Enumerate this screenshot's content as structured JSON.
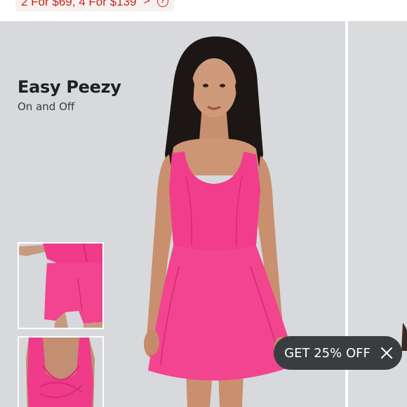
{
  "promo": {
    "text": "2 For $69, 4 For $139",
    "arrow": ">",
    "help": "?"
  },
  "product": {
    "title": "Easy Peezy",
    "subtitle": "On and Off"
  },
  "discount": {
    "label": "GET 25% OFF"
  },
  "colors": {
    "promo_text": "#c8261f",
    "stage_bg": "#d7d9dc",
    "dress_pink": "#f23d8d",
    "pill_bg": "#3a3d40"
  },
  "icons": [
    "chevron-right-icon",
    "help-circle-icon",
    "close-icon"
  ]
}
